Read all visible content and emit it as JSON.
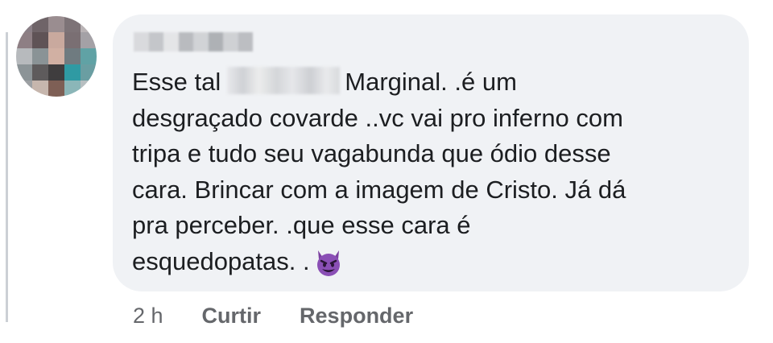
{
  "comment": {
    "avatar_icon": "blurred-profile-photo",
    "author_name_icon": "pixelated-author-name",
    "redaction_icon": "pixelated-redacted-name",
    "lines": [
      {
        "before": "Esse tal",
        "after": "Marginal. .é  um"
      },
      "desgraçado covarde ..vc vai pro inferno com",
      "tripa e tudo seu vagabunda que ódio desse",
      "cara. Brincar com a imagem de Cristo. Já dá",
      "pra perceber. .que esse cara é",
      "esquedopatas. ."
    ],
    "emoji": "smiling-face-with-horns-emoji",
    "colors": {
      "bubble": "#f0f2f5",
      "text": "#1c1e21",
      "meta": "#65676b"
    }
  },
  "actions": {
    "time": "2 h",
    "like": "Curtir",
    "reply": "Responder"
  }
}
